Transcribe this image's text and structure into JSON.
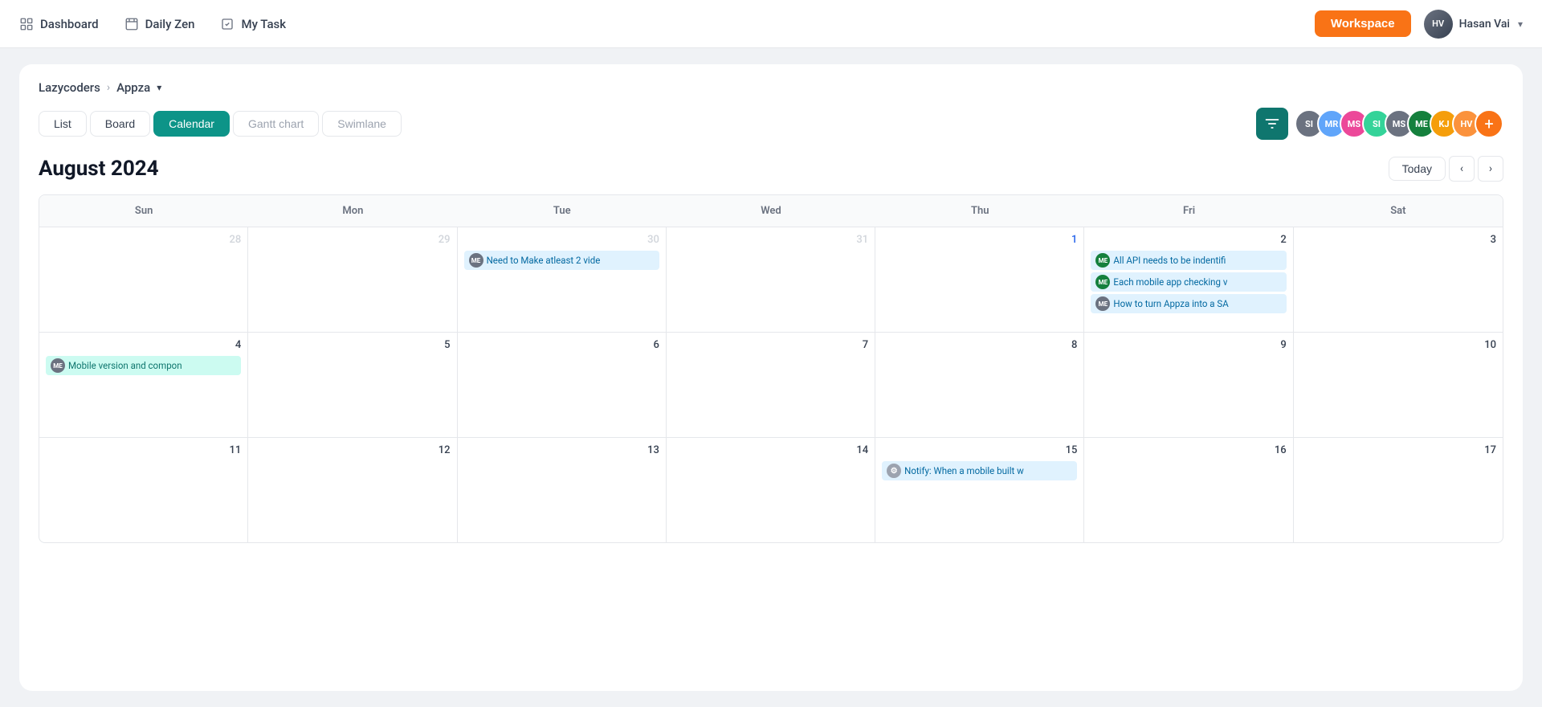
{
  "topnav": {
    "dashboard_label": "Dashboard",
    "daily_zen_label": "Daily Zen",
    "my_task_label": "My Task",
    "workspace_label": "Workspace",
    "user_name": "Hasan Vai",
    "user_initials": "HV"
  },
  "breadcrumb": {
    "workspace_label": "Lazycoders",
    "project_label": "Appza"
  },
  "tabs": {
    "list_label": "List",
    "board_label": "Board",
    "calendar_label": "Calendar",
    "gantt_label": "Gantt chart",
    "swimlane_label": "Swimlane"
  },
  "calendar": {
    "month_title": "August 2024",
    "today_label": "Today",
    "days": [
      "Sun",
      "Mon",
      "Tue",
      "Wed",
      "Thu",
      "Fri",
      "Sat"
    ],
    "weeks": [
      {
        "cells": [
          {
            "date": "28",
            "month": "other",
            "tasks": []
          },
          {
            "date": "29",
            "month": "other",
            "tasks": []
          },
          {
            "date": "30",
            "month": "other",
            "tasks": [
              {
                "text": "Need to Make atleast 2 vide",
                "avatar_color": "#6b7280",
                "avatar_initials": "ME",
                "type": "blue"
              }
            ]
          },
          {
            "date": "31",
            "month": "other",
            "tasks": []
          },
          {
            "date": "1",
            "month": "current",
            "tasks": []
          },
          {
            "date": "2",
            "month": "current",
            "tasks": [
              {
                "text": "All API needs to be indentifi",
                "avatar_color": "#15803d",
                "avatar_initials": "ME",
                "type": "blue"
              },
              {
                "text": "Each mobile app checking v",
                "avatar_color": "#15803d",
                "avatar_initials": "ME",
                "type": "blue"
              },
              {
                "text": "How to turn Appza into a SA",
                "avatar_color": "#6b7280",
                "avatar_initials": "ME",
                "type": "blue"
              }
            ]
          },
          {
            "date": "3",
            "month": "current",
            "tasks": []
          }
        ]
      },
      {
        "cells": [
          {
            "date": "4",
            "month": "current",
            "tasks": [
              {
                "text": "Mobile version and compon",
                "avatar_color": "#6b7280",
                "avatar_initials": "ME",
                "type": "teal"
              }
            ]
          },
          {
            "date": "5",
            "month": "current",
            "tasks": []
          },
          {
            "date": "6",
            "month": "current",
            "tasks": []
          },
          {
            "date": "7",
            "month": "current",
            "tasks": []
          },
          {
            "date": "8",
            "month": "current",
            "tasks": []
          },
          {
            "date": "9",
            "month": "current",
            "tasks": []
          },
          {
            "date": "10",
            "month": "current",
            "tasks": []
          }
        ]
      },
      {
        "cells": [
          {
            "date": "11",
            "month": "current",
            "tasks": []
          },
          {
            "date": "12",
            "month": "current",
            "tasks": []
          },
          {
            "date": "13",
            "month": "current",
            "tasks": []
          },
          {
            "date": "14",
            "month": "current",
            "tasks": []
          },
          {
            "date": "15",
            "month": "current",
            "tasks": [
              {
                "text": "Notify: When a mobile built w",
                "avatar_color": "#9ca3af",
                "avatar_initials": "",
                "type": "blue",
                "icon": "gear"
              }
            ]
          },
          {
            "date": "16",
            "month": "current",
            "tasks": []
          },
          {
            "date": "17",
            "month": "current",
            "tasks": []
          }
        ]
      }
    ],
    "members": [
      {
        "initials": "SI",
        "bg": "#a78bfa"
      },
      {
        "initials": "MR",
        "bg": "#60a5fa"
      },
      {
        "initials": "MS",
        "bg": "#f472b6"
      },
      {
        "initials": "SI",
        "bg": "#34d399"
      },
      {
        "initials": "MS",
        "bg": "#6b7280"
      },
      {
        "initials": "ME",
        "bg": "#4ade80"
      },
      {
        "initials": "KJ",
        "bg": "#f59e0b"
      },
      {
        "initials": "HV",
        "bg": "#fb923c"
      }
    ]
  }
}
